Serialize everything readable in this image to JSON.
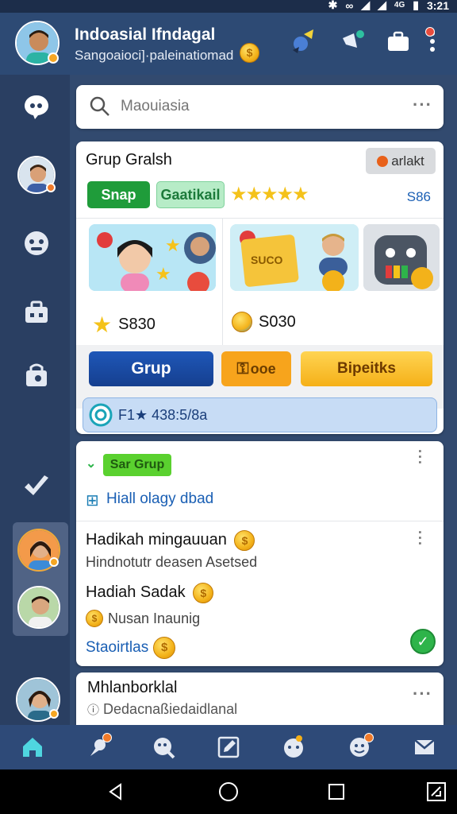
{
  "status_bar": {
    "time": "3:21",
    "net": "4G"
  },
  "header": {
    "title": "Indoasial Ifndagal",
    "subtitle": "Sangoaioci]·paleinatiomad",
    "coin": "$"
  },
  "search": {
    "placeholder": "Maouiasia"
  },
  "card1": {
    "title": "Grup Gralsh",
    "tag": "arlakt",
    "pill_shop": "Snap",
    "pill_special": "Gaatikail",
    "stars": "★★★★★",
    "amount": "S86",
    "price_left": "S830",
    "price_right": "S030",
    "btn_group": "Grup",
    "btn_mid": "ooe",
    "btn_right": "Bipeitks",
    "footer": "F1★ 438:5/8a"
  },
  "card2": {
    "tag": "Sar Grup",
    "link": "Hiall olagy dbad",
    "item1_title": "Hadikah mingauuan",
    "item1_sub": "Hindnotutr deasen Asetsed",
    "item2_title": "Hadiah Sadak",
    "item2_sub": "Nusan Inaunig",
    "footer_link": "Staoirtlas"
  },
  "card3": {
    "title": "Mhlanborklal",
    "sub": "Dedacnaßiedaidlanal"
  },
  "colors": {
    "header": "#2d4a74",
    "sidebar": "#2a3f62",
    "content": "#324a6f",
    "accent_blue": "#1a5fb4",
    "accent_green": "#1f9c3a",
    "accent_yellow": "#f5b018"
  }
}
